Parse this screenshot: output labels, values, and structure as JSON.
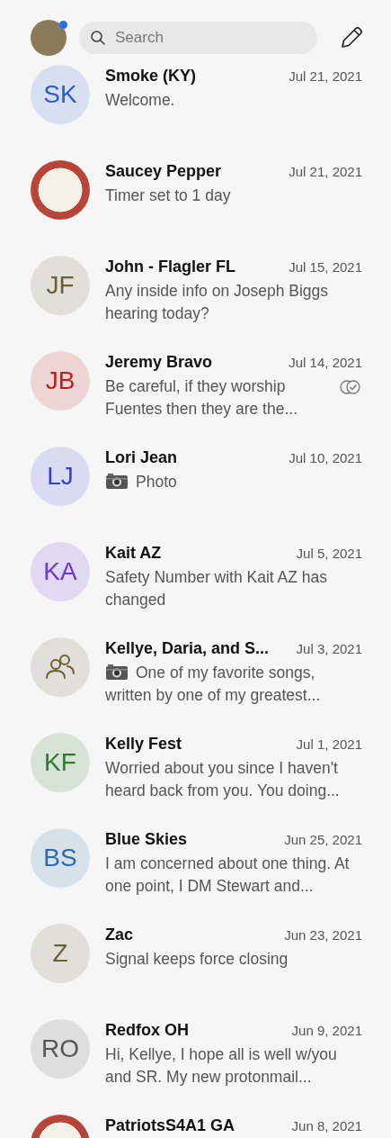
{
  "header": {
    "profile_badge": true,
    "search": {
      "placeholder": "Search"
    }
  },
  "conversations": [
    {
      "avatar": {
        "kind": "initials",
        "text": "SK",
        "color": "#2a5bd7"
      },
      "name": "Smoke (KY)",
      "date": "Jul 21, 2021",
      "preview": "Welcome.",
      "photo": false,
      "read_receipt": false
    },
    {
      "avatar": {
        "kind": "image"
      },
      "name": "Saucey Pepper",
      "date": "Jul 21, 2021",
      "preview": "Timer set to 1 day",
      "photo": false,
      "read_receipt": false
    },
    {
      "avatar": {
        "kind": "initials",
        "text": "JF",
        "color": "#6b6033"
      },
      "name": "John - Flagler FL",
      "date": "Jul 15, 2021",
      "preview": "Any inside info on Joseph Biggs hearing today?",
      "photo": false,
      "read_receipt": false
    },
    {
      "avatar": {
        "kind": "initials",
        "text": "JB",
        "color": "#c21d1d"
      },
      "name": "Jeremy Bravo",
      "date": "Jul 14, 2021",
      "preview": "Be careful, if they worship Fuentes then they are the...",
      "photo": false,
      "read_receipt": true
    },
    {
      "avatar": {
        "kind": "initials",
        "text": "LJ",
        "color": "#3540d8"
      },
      "name": "Lori Jean",
      "date": "Jul 10, 2021",
      "preview": "Photo",
      "photo": true,
      "read_receipt": false
    },
    {
      "avatar": {
        "kind": "initials",
        "text": "KA",
        "color": "#6b35e0"
      },
      "name": "Kait AZ",
      "date": "Jul 5, 2021",
      "preview": "Safety Number with Kait AZ has changed",
      "photo": false,
      "read_receipt": false
    },
    {
      "avatar": {
        "kind": "group",
        "color": "#6b6033"
      },
      "name": "Kellye, Daria, and S...",
      "date": "Jul 3, 2021",
      "preview": "One of my favorite songs, written by one of my greatest...",
      "photo": true,
      "read_receipt": false
    },
    {
      "avatar": {
        "kind": "initials",
        "text": "KF",
        "color": "#2e7a2e"
      },
      "name": "Kelly Fest",
      "date": "Jul 1, 2021",
      "preview": "Worried about you since I haven't heard back from you. You doing...",
      "photo": false,
      "read_receipt": false
    },
    {
      "avatar": {
        "kind": "initials",
        "text": "BS",
        "color": "#2a6aa8"
      },
      "name": "Blue Skies",
      "date": "Jun 25, 2021",
      "preview": "I am concerned about one thing. At one point, I DM Stewart and...",
      "photo": false,
      "read_receipt": false
    },
    {
      "avatar": {
        "kind": "initials",
        "text": "Z",
        "color": "#6b6033"
      },
      "name": "Zac",
      "date": "Jun 23, 2021",
      "preview": "Signal keeps force closing",
      "photo": false,
      "read_receipt": false
    },
    {
      "avatar": {
        "kind": "initials",
        "text": "RO",
        "color": "#555555"
      },
      "name": "Redfox OH",
      "date": "Jun 9, 2021",
      "preview": "Hi, Kellye, I hope all is well w/you and SR. My new protonmail...",
      "photo": false,
      "read_receipt": false
    },
    {
      "avatar": {
        "kind": "image"
      },
      "name": "PatriotsS4A1 GA",
      "date": "Jun 8, 2021",
      "photo": false,
      "read_receipt": false
    }
  ]
}
